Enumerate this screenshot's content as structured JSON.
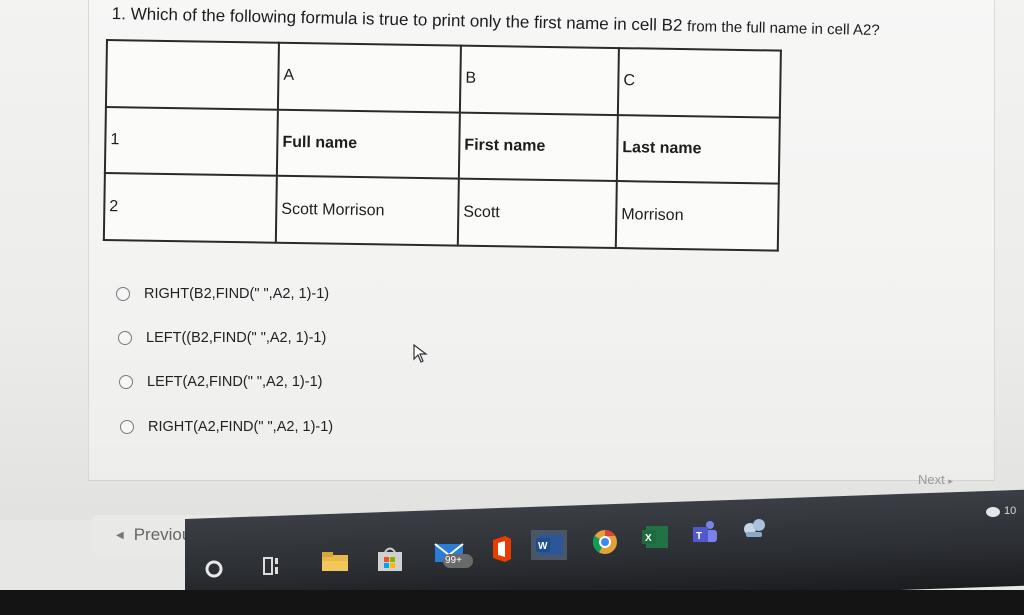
{
  "question": {
    "number": "1.",
    "text_a": "Which of the following formula is true to print only the first name in cell B2",
    "text_b": "from the full name in cell A2?"
  },
  "sheet": {
    "col_headers": [
      "A",
      "B",
      "C"
    ],
    "rows": [
      {
        "row": "1",
        "cells": [
          "Full name",
          "First name",
          "Last name"
        ]
      },
      {
        "row": "2",
        "cells": [
          "Scott Morrison",
          "Scott",
          "Morrison"
        ]
      }
    ]
  },
  "options": [
    "RIGHT(B2,FIND(\" \",A2, 1)-1)",
    "LEFT((B2,FIND(\" \",A2, 1)-1)",
    "LEFT(A2,FIND(\" \",A2, 1)-1)",
    "RIGHT(A2,FIND(\" \",A2, 1)-1)"
  ],
  "nav": {
    "next_label": "Next",
    "previous_label": "Previous"
  },
  "taskbar": {
    "mail_badge": "99+",
    "clock_fragment": "10"
  }
}
